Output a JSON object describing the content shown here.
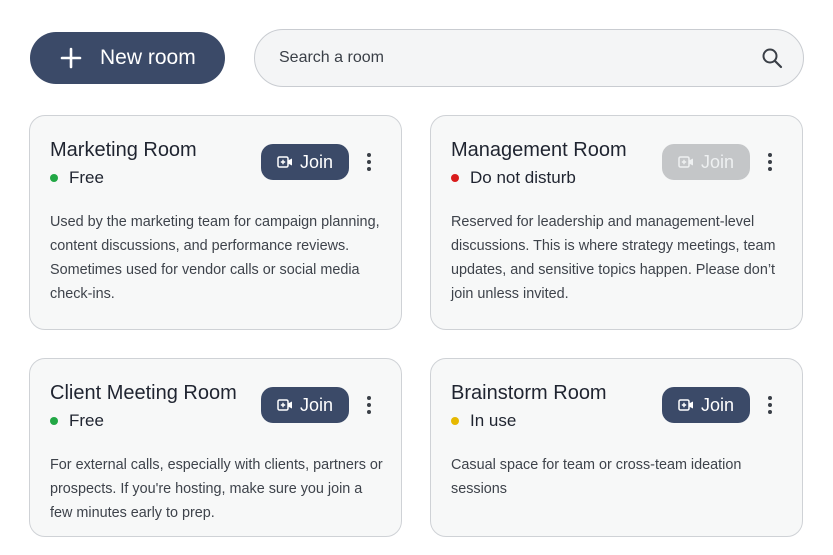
{
  "toolbar": {
    "new_room_label": "New room",
    "search_placeholder": "Search a room"
  },
  "rooms": [
    {
      "title": "Marketing Room",
      "status": "Free",
      "status_color": "#22a745",
      "join_label": "Join",
      "join_enabled": true,
      "description": "Used by the marketing team for campaign planning, content discussions, and performance reviews. Sometimes used for vendor calls or social media check-ins."
    },
    {
      "title": "Management Room",
      "status": "Do not disturb",
      "status_color": "#d91c1c",
      "join_label": "Join",
      "join_enabled": false,
      "description": "Reserved for leadership and management-level discussions. This is where strategy meetings, team updates, and sensitive topics happen. Please don’t join unless invited."
    },
    {
      "title": "Client Meeting Room",
      "status": "Free",
      "status_color": "#22a745",
      "join_label": "Join",
      "join_enabled": true,
      "description": "For external calls, especially with clients, partners or prospects. If you're hosting, make sure you join a few minutes early to prep."
    },
    {
      "title": "Brainstorm Room",
      "status": "In use",
      "status_color": "#e6b800",
      "join_label": "Join",
      "join_enabled": true,
      "description": "Casual space for team or cross-team ideation sessions"
    }
  ]
}
